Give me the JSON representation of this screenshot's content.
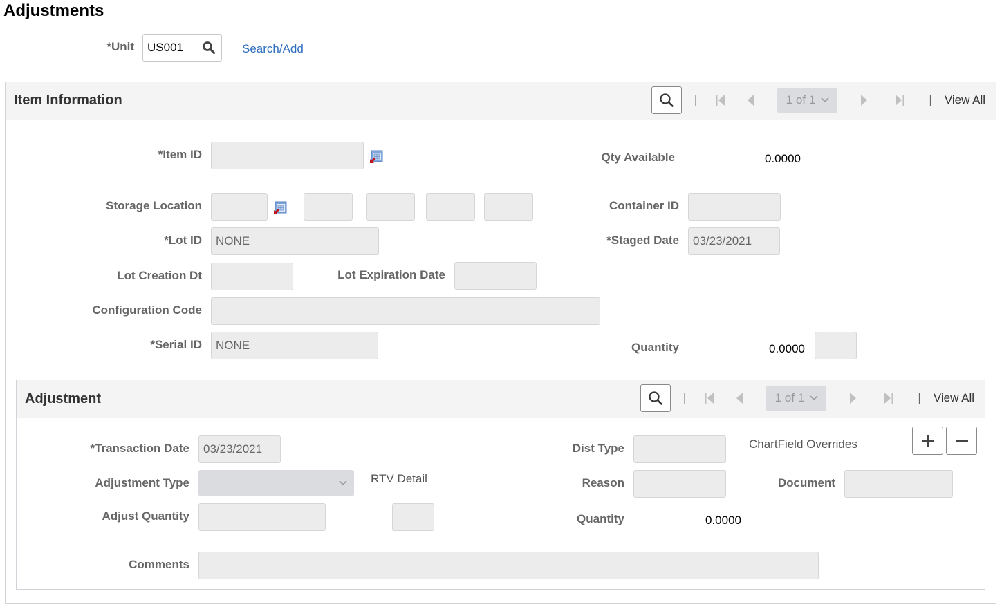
{
  "page": {
    "title": "Adjustments"
  },
  "search_bar": {
    "unit_label": "*Unit",
    "unit_value": "US001",
    "search_add_link": "Search/Add"
  },
  "item_information": {
    "title": "Item Information",
    "nav": {
      "pager": "1 of 1",
      "separator": "|",
      "view_all": "View All"
    },
    "fields": {
      "item_id": {
        "label": "*Item ID",
        "value": ""
      },
      "qty_available": {
        "label": "Qty Available",
        "value": "0.0000"
      },
      "storage_location": {
        "label": "Storage Location",
        "values": [
          "",
          "",
          "",
          "",
          ""
        ]
      },
      "container_id": {
        "label": "Container ID",
        "value": ""
      },
      "lot_id": {
        "label": "*Lot ID",
        "value": "NONE"
      },
      "staged_date": {
        "label": "*Staged Date",
        "value": "03/23/2021"
      },
      "lot_creation_dt": {
        "label": "Lot Creation Dt",
        "value": ""
      },
      "lot_expiration_date": {
        "label": "Lot Expiration Date",
        "value": ""
      },
      "configuration_code": {
        "label": "Configuration Code",
        "value": ""
      },
      "serial_id": {
        "label": "*Serial ID",
        "value": "NONE"
      },
      "quantity": {
        "label": "Quantity",
        "value": "0.0000",
        "uom": ""
      }
    }
  },
  "adjustment": {
    "title": "Adjustment",
    "nav": {
      "pager": "1 of 1",
      "separator": "|",
      "view_all": "View All"
    },
    "fields": {
      "transaction_date": {
        "label": "*Transaction Date",
        "value": "03/23/2021"
      },
      "dist_type": {
        "label": "Dist Type",
        "value": ""
      },
      "chartfield_overrides": {
        "label": "ChartField Overrides"
      },
      "adjustment_type": {
        "label": "Adjustment Type",
        "value": ""
      },
      "rtv_detail": {
        "label": "RTV Detail"
      },
      "reason": {
        "label": "Reason",
        "value": ""
      },
      "document": {
        "label": "Document",
        "value": ""
      },
      "adjust_quantity": {
        "label": "Adjust Quantity",
        "value": "",
        "uom": ""
      },
      "quantity": {
        "label": "Quantity",
        "value": "0.0000"
      },
      "comments": {
        "label": "Comments",
        "value": ""
      }
    }
  },
  "icons": {
    "search": "magnifier-icon",
    "lookup": "prompt-lookup-icon",
    "first": "first-page-icon",
    "prev": "previous-page-icon",
    "next": "next-page-icon",
    "last": "last-page-icon",
    "add_row": "plus-icon",
    "delete_row": "minus-icon"
  }
}
